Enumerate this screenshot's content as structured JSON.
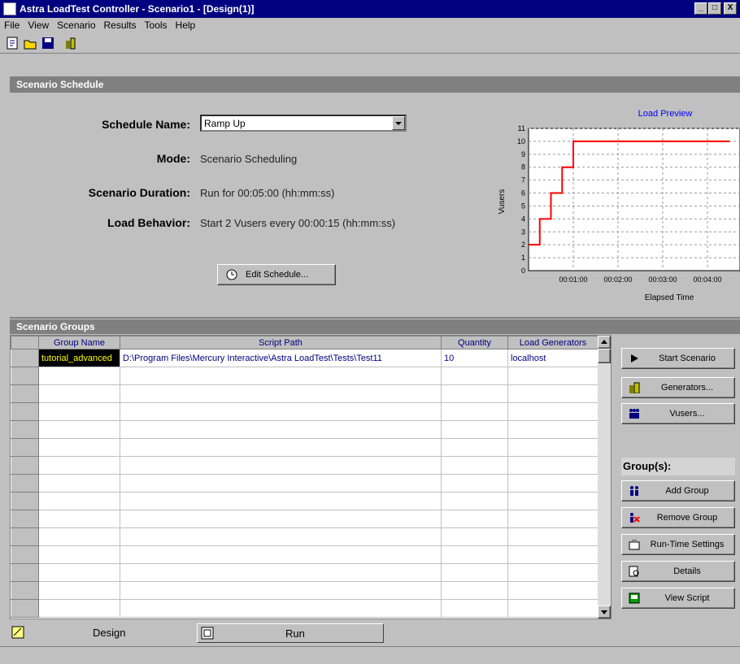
{
  "window": {
    "title": "Astra LoadTest Controller - Scenario1 - [Design(1)]",
    "buttons": [
      "_",
      "□",
      "X"
    ]
  },
  "menu": [
    "File",
    "View",
    "Scenario",
    "Results",
    "Tools",
    "Help"
  ],
  "toolbar": [
    "new-scenario-icon",
    "open-icon",
    "save-icon",
    "generators-icon"
  ],
  "schedule": {
    "header": "Scenario Schedule",
    "schedule_name_label": "Schedule Name:",
    "schedule_name_value": "Ramp Up",
    "mode_label": "Mode:",
    "mode_value": "Scenario Scheduling",
    "duration_label": "Scenario Duration:",
    "duration_value": "Run for 00:05:00 (hh:mm:ss)",
    "behavior_label": "Load Behavior:",
    "behavior_value": "Start 2 Vusers every 00:00:15 (hh:mm:ss)",
    "edit_button": "Edit Schedule..."
  },
  "chart_data": {
    "type": "line",
    "title": "Load Preview",
    "xlabel": "Elapsed Time",
    "ylabel": "Vusers",
    "x_ticks": [
      "00:01:00",
      "00:02:00",
      "00:03:00",
      "00:04:00"
    ],
    "y_ticks": [
      0,
      1,
      2,
      3,
      4,
      5,
      6,
      7,
      8,
      9,
      10,
      11
    ],
    "ylim": [
      0,
      11
    ],
    "series": [
      {
        "points": [
          [
            0,
            2
          ],
          [
            15,
            2
          ],
          [
            15,
            4
          ],
          [
            30,
            4
          ],
          [
            30,
            6
          ],
          [
            45,
            6
          ],
          [
            45,
            8
          ],
          [
            60,
            8
          ],
          [
            60,
            10
          ],
          [
            270,
            10
          ]
        ]
      }
    ],
    "color": "#ff0000"
  },
  "groups": {
    "header": "Scenario Groups",
    "columns": [
      "Group Name",
      "Script Path",
      "Quantity",
      "Load Generators"
    ],
    "rows": [
      [
        "tutorial_advanced",
        "D:\\Program Files\\Mercury Interactive\\Astra LoadTest\\Tests\\Test11",
        "10",
        "localhost"
      ]
    ],
    "empty_rows": 14
  },
  "side_buttons": {
    "start": "Start Scenario",
    "generators": "Generators...",
    "vusers": "Vusers...",
    "group_label": "Group(s):",
    "add_group": "Add Group",
    "remove_group": "Remove Group",
    "runtime": "Run-Time Settings",
    "details": "Details",
    "view_script": "View Script"
  },
  "tabs": {
    "design": "Design",
    "run": "Run"
  }
}
